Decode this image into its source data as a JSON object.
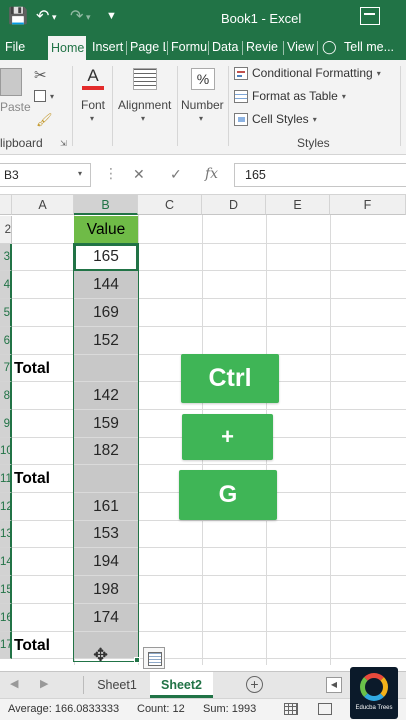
{
  "app": {
    "title": "Book1 - Excel",
    "accent": "#217346"
  },
  "tabs": [
    {
      "label": "File",
      "active": false
    },
    {
      "label": "Home",
      "active": true
    },
    {
      "label": "Insert",
      "active": false
    },
    {
      "label": "Page L",
      "active": false
    },
    {
      "label": "Formu",
      "active": false
    },
    {
      "label": "Data",
      "active": false
    },
    {
      "label": "Revie",
      "active": false
    },
    {
      "label": "View",
      "active": false
    },
    {
      "label": "Tell me...",
      "active": false
    }
  ],
  "ribbon": {
    "paste_label": "Paste",
    "clipboard_label": "lipboard",
    "font_label": "Font",
    "alignment_label": "Alignment",
    "number_label": "Number",
    "number_glyph": "%",
    "font_glyph": "A",
    "styles_label": "Styles",
    "conditional_formatting": "Conditional Formatting",
    "format_as_table": "Format as Table",
    "cell_styles": "Cell Styles"
  },
  "formula_bar": {
    "name_box": "B3",
    "fx": "fx",
    "value": "165"
  },
  "columns": [
    "A",
    "B",
    "C",
    "D",
    "E",
    "F"
  ],
  "rows": [
    {
      "num": "2",
      "a": "",
      "b": "Value",
      "type": "hdr"
    },
    {
      "num": "3",
      "a": "",
      "b": "165",
      "type": "first"
    },
    {
      "num": "4",
      "a": "",
      "b": "144",
      "type": "blank"
    },
    {
      "num": "5",
      "a": "",
      "b": "169",
      "type": "blank"
    },
    {
      "num": "6",
      "a": "",
      "b": "152",
      "type": "blank"
    },
    {
      "num": "7",
      "a": "Total",
      "b": "",
      "type": "blank"
    },
    {
      "num": "8",
      "a": "",
      "b": "142",
      "type": "blank"
    },
    {
      "num": "9",
      "a": "",
      "b": "159",
      "type": "blank"
    },
    {
      "num": "10",
      "a": "",
      "b": "182",
      "type": "blank"
    },
    {
      "num": "11",
      "a": "Total",
      "b": "",
      "type": "blank"
    },
    {
      "num": "12",
      "a": "",
      "b": "161",
      "type": "blank"
    },
    {
      "num": "13",
      "a": "",
      "b": "153",
      "type": "blank"
    },
    {
      "num": "14",
      "a": "",
      "b": "194",
      "type": "blank"
    },
    {
      "num": "15",
      "a": "",
      "b": "198",
      "type": "blank"
    },
    {
      "num": "16",
      "a": "",
      "b": "174",
      "type": "blank"
    },
    {
      "num": "17",
      "a": "Total",
      "b": "",
      "type": "blank"
    }
  ],
  "keys": {
    "ctrl": "Ctrl",
    "plus": "+",
    "g": "G",
    "color": "#3fb556"
  },
  "sheets": [
    {
      "label": "Sheet1",
      "active": false
    },
    {
      "label": "Sheet2",
      "active": true
    }
  ],
  "status": {
    "average": "Average: 166.0833333",
    "count": "Count: 12",
    "sum": "Sum: 1993"
  },
  "watermark": "Educba Trees"
}
